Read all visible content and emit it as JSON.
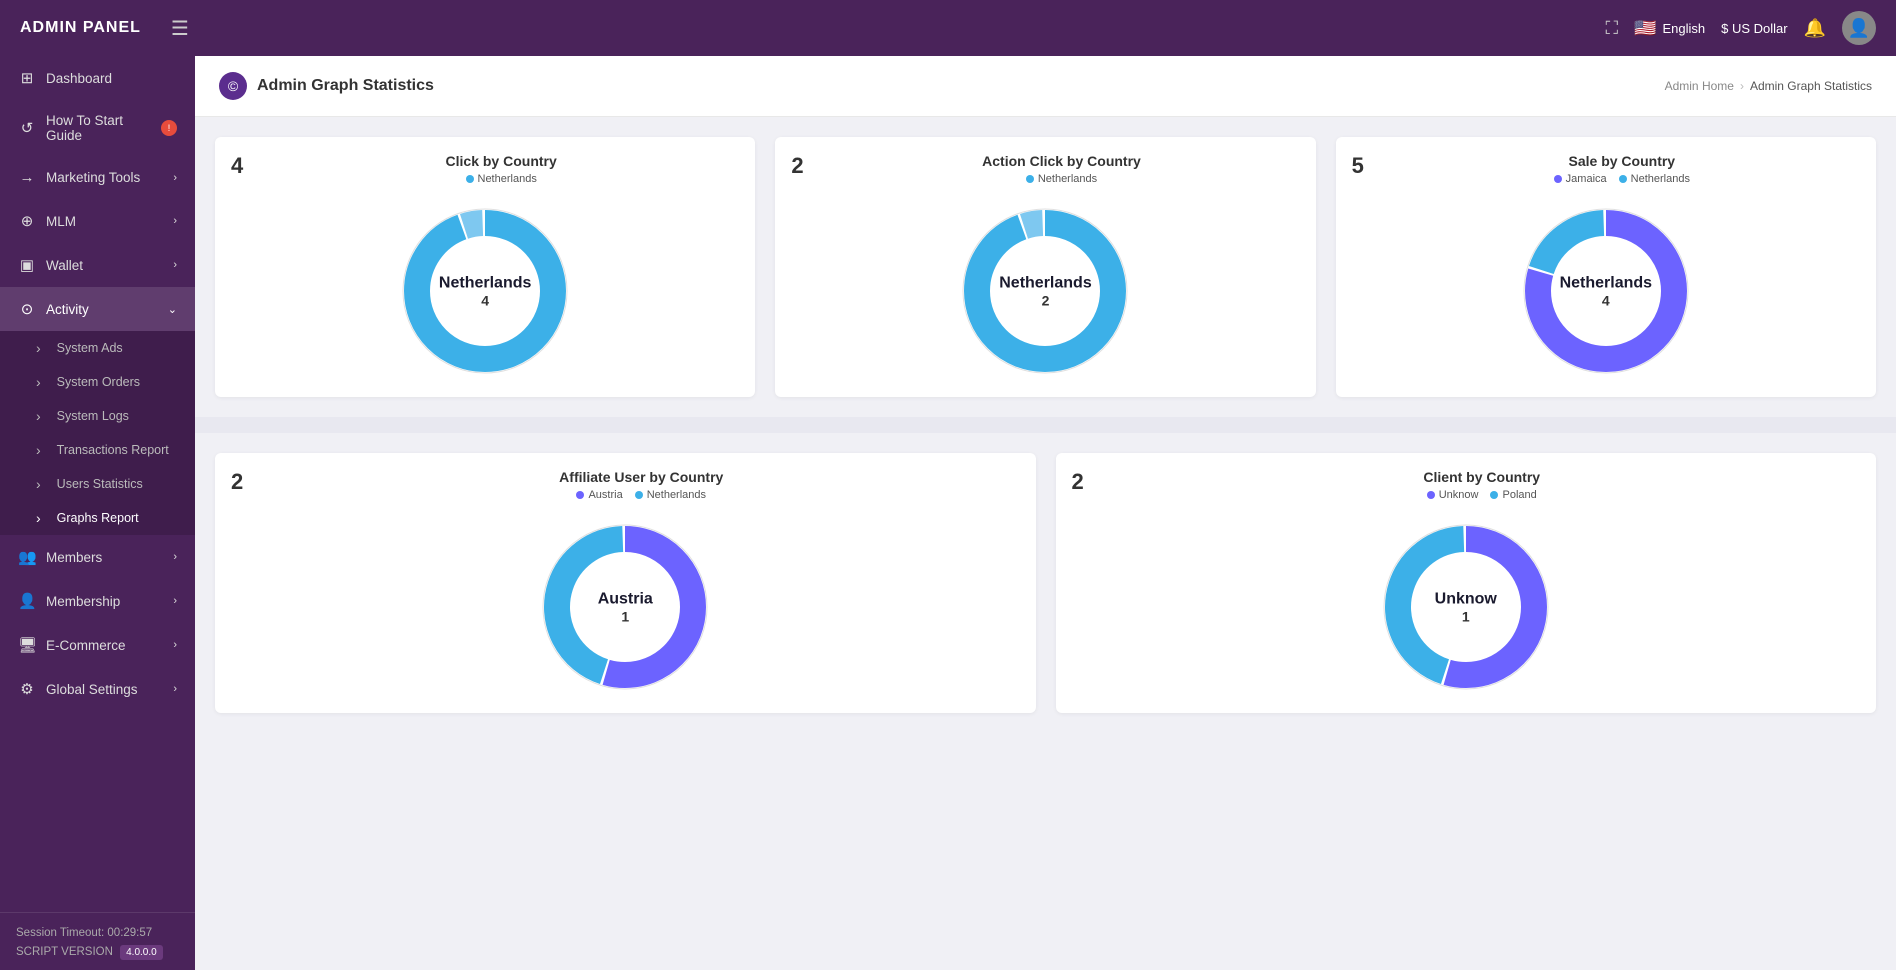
{
  "header": {
    "brand": "ADMIN PANEL",
    "lang": "English",
    "currency": "$ US Dollar"
  },
  "breadcrumb": {
    "home": "Admin Home",
    "current": "Admin Graph Statistics"
  },
  "pageTitle": "Admin Graph Statistics",
  "sidebar": {
    "items": [
      {
        "id": "dashboard",
        "label": "Dashboard",
        "icon": "⊞",
        "hasChevron": false,
        "badge": null
      },
      {
        "id": "how-to-start",
        "label": "How To Start Guide",
        "icon": "↺",
        "hasChevron": false,
        "badge": "!"
      },
      {
        "id": "marketing-tools",
        "label": "Marketing Tools",
        "icon": "→",
        "hasChevron": true,
        "badge": null
      },
      {
        "id": "mlm",
        "label": "MLM",
        "icon": "⊕",
        "hasChevron": true,
        "badge": null
      },
      {
        "id": "wallet",
        "label": "Wallet",
        "icon": "▣",
        "hasChevron": true,
        "badge": null
      },
      {
        "id": "activity",
        "label": "Activity",
        "icon": "⊙",
        "hasChevron": true,
        "badge": null,
        "expanded": true
      },
      {
        "id": "members",
        "label": "Members",
        "icon": "👤",
        "hasChevron": true,
        "badge": null
      },
      {
        "id": "membership",
        "label": "Membership",
        "icon": "👤",
        "hasChevron": true,
        "badge": null
      },
      {
        "id": "ecommerce",
        "label": "E-Commerce",
        "icon": "🖥",
        "hasChevron": true,
        "badge": null
      },
      {
        "id": "global-settings",
        "label": "Global Settings",
        "icon": "⚙",
        "hasChevron": true,
        "badge": null
      }
    ],
    "subItems": [
      {
        "id": "system-ads",
        "label": "System Ads"
      },
      {
        "id": "system-orders",
        "label": "System Orders"
      },
      {
        "id": "system-logs",
        "label": "System Logs"
      },
      {
        "id": "transactions-report",
        "label": "Transactions Report"
      },
      {
        "id": "users-statistics",
        "label": "Users Statistics"
      },
      {
        "id": "graphs-report",
        "label": "Graphs Report",
        "active": true
      }
    ],
    "sessionTimeout": "Session Timeout: 00:29:57",
    "scriptVersion": "SCRIPT VERSION",
    "versionNumber": "4.0.0.0"
  },
  "charts": {
    "row1": [
      {
        "id": "click-by-country",
        "count": "4",
        "title": "Click by Country",
        "legend": [
          {
            "label": "Netherlands",
            "color": "#3cb0e8"
          }
        ],
        "centerLabel": "Netherlands",
        "centerValue": "4",
        "segments": [
          {
            "color": "#3cb0e8",
            "pct": 0.95
          },
          {
            "color": "#7ec8f0",
            "pct": 0.05
          }
        ]
      },
      {
        "id": "action-click-by-country",
        "count": "2",
        "title": "Action Click by Country",
        "legend": [
          {
            "label": "Netherlands",
            "color": "#3cb0e8"
          }
        ],
        "centerLabel": "Netherlands",
        "centerValue": "2",
        "segments": [
          {
            "color": "#3cb0e8",
            "pct": 0.95
          },
          {
            "color": "#7ec8f0",
            "pct": 0.05
          }
        ]
      },
      {
        "id": "sale-by-country",
        "count": "5",
        "title": "Sale by Country",
        "legend": [
          {
            "label": "Jamaica",
            "color": "#6c63ff"
          },
          {
            "label": "Netherlands",
            "color": "#3cb0e8"
          }
        ],
        "centerLabel": "Netherlands",
        "centerValue": "4",
        "segments": [
          {
            "color": "#6c63ff",
            "pct": 0.8
          },
          {
            "color": "#3cb0e8",
            "pct": 0.2
          }
        ]
      }
    ],
    "row2": [
      {
        "id": "affiliate-user-by-country",
        "count": "2",
        "title": "Affiliate User by Country",
        "legend": [
          {
            "label": "Austria",
            "color": "#6c63ff"
          },
          {
            "label": "Netherlands",
            "color": "#3cb0e8"
          }
        ],
        "centerLabel": "Austria",
        "centerValue": "1",
        "segments": [
          {
            "color": "#6c63ff",
            "pct": 0.55
          },
          {
            "color": "#3cb0e8",
            "pct": 0.45
          }
        ]
      },
      {
        "id": "client-by-country",
        "count": "2",
        "title": "Client by Country",
        "legend": [
          {
            "label": "Unknow",
            "color": "#6c63ff"
          },
          {
            "label": "Poland",
            "color": "#3cb0e8"
          }
        ],
        "centerLabel": "Unknow",
        "centerValue": "1",
        "segments": [
          {
            "color": "#6c63ff",
            "pct": 0.55
          },
          {
            "color": "#3cb0e8",
            "pct": 0.45
          }
        ]
      }
    ]
  }
}
